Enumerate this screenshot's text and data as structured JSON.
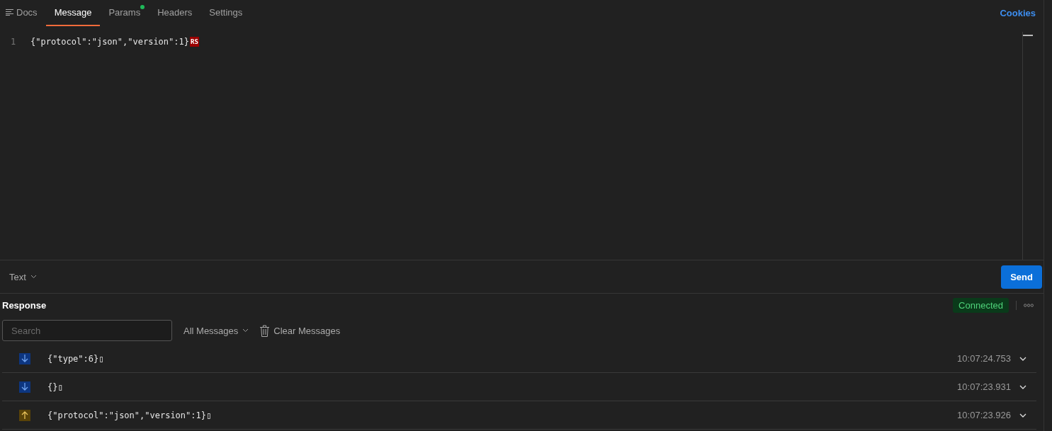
{
  "tabs": [
    {
      "label": "Docs",
      "selected": false,
      "indicator": false,
      "kind": "docs"
    },
    {
      "label": "Message",
      "selected": true,
      "indicator": false,
      "kind": "plain"
    },
    {
      "label": "Params",
      "selected": false,
      "indicator": true,
      "kind": "plain"
    },
    {
      "label": "Headers",
      "selected": false,
      "indicator": false,
      "kind": "plain"
    },
    {
      "label": "Settings",
      "selected": false,
      "indicator": false,
      "kind": "plain"
    }
  ],
  "cookies_link": "Cookies",
  "editor": {
    "lines": [
      {
        "number": "1",
        "text": "{\"protocol\":\"json\",\"version\":1}",
        "control_mark": "RS"
      }
    ]
  },
  "format_dropdown": "Text",
  "send_button": "Send",
  "response": {
    "title": "Response",
    "status": "Connected",
    "search": {
      "placeholder": "Search"
    },
    "filter_dropdown": "All Messages",
    "clear_button": "Clear Messages",
    "messages": [
      {
        "kind": "incoming",
        "text": "{\"type\":6}▯",
        "time": "10:07:24.753"
      },
      {
        "kind": "incoming",
        "text": "{}▯",
        "time": "10:07:23.931"
      },
      {
        "kind": "outgoing",
        "text": "{\"protocol\":\"json\",\"version\":1}▯",
        "time": "10:07:23.926"
      }
    ]
  }
}
